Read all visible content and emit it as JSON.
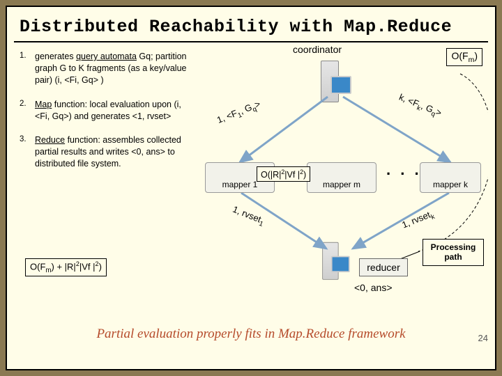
{
  "title": "Distributed Reachability with Map.Reduce",
  "steps": [
    {
      "num": "1.",
      "text_pre": "generates ",
      "term": "query automata",
      "text_post": " Gq;  partition graph G to K fragments (as a key/value pair) (i, <Fi, Gq> )"
    },
    {
      "num": "2.",
      "term": "Map",
      "term_post": " function: ",
      "text_post": "local evaluation upon (i, <Fi, Gq>) and generates <1, rvset>"
    },
    {
      "num": "3.",
      "term": "Reduce",
      "term_post": " function: ",
      "text_post": "assembles collected partial results and writes <0, ans> to distributed file system."
    }
  ],
  "left_cost": "O(F",
  "left_cost_sub": "m",
  "left_cost_tail": ") + |R|",
  "left_cost_sup": "2",
  "left_cost_tail2": "|Vf |",
  "left_cost_tail3": ")",
  "diagram": {
    "coordinator": "coordinator",
    "ofm_pre": "O(F",
    "ofm_sub": "m",
    "ofm_post": ")",
    "edge1": "1, <F",
    "edge1_sub": "1",
    "edge1_post": ", G",
    "edge1_sub2": "q",
    "edge1_tail": ">",
    "edgek": "k, <F",
    "edgek_sub": "k",
    "edgek_post": ", G",
    "edgek_sub2": "q",
    "edgek_tail": ">",
    "mapper1": "mapper 1",
    "mapperm": "mapper m",
    "mapperk": "mapper k",
    "dots": ". . .",
    "mapper_cost_pre": "O(|R|",
    "mapper_cost_sup": "2",
    "mapper_cost_mid": "|Vf |",
    "mapper_cost_post": ")",
    "rv1_pre": "1, rvset",
    "rv1_sub": "1",
    "rvk_pre": "1, rvset",
    "rvk_sub": "k",
    "reducer": "reducer",
    "proc_path": "Processing path",
    "out": "<0, ans>"
  },
  "caption": "Partial evaluation properly fits in Map.Reduce framework",
  "pagenum": "24"
}
